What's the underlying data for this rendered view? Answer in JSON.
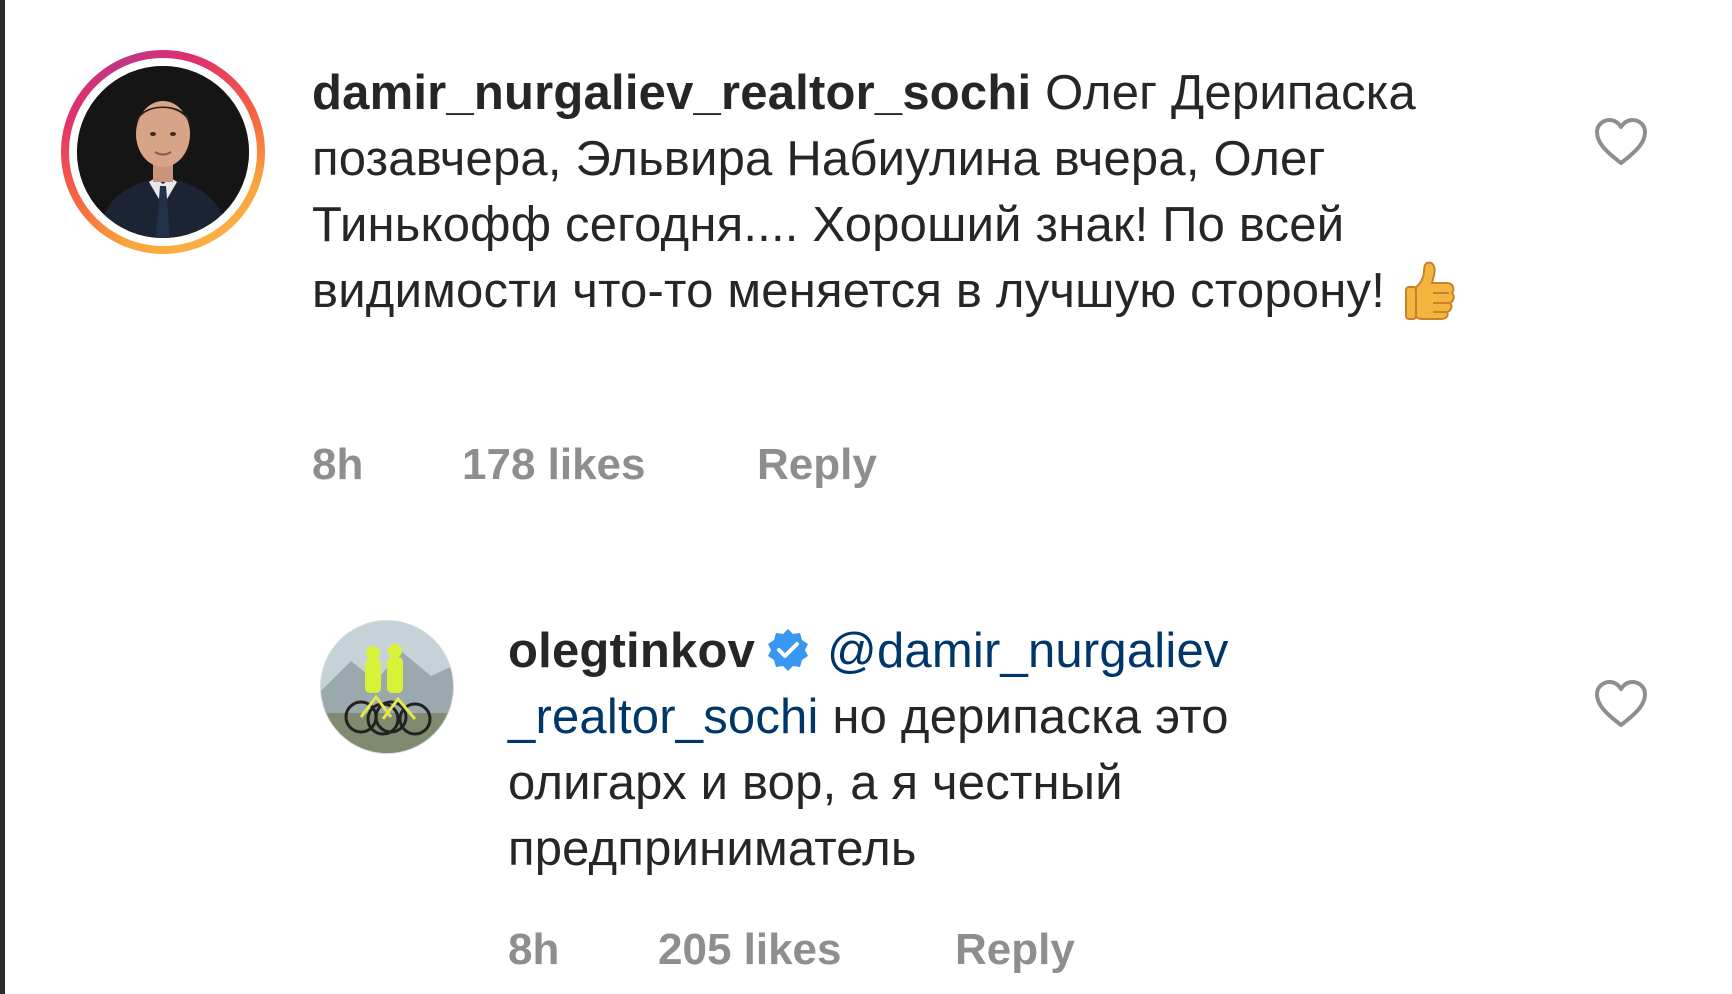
{
  "comments": [
    {
      "username": "damir_nurgaliev_realtor_sochi",
      "text": " Олег Дерипаска позавчера, Эльвира Набиулина вчера, Олег Тинькофф сегодня.... Хороший знак! По всей видимости что-то меняется в лучшую сторону!",
      "emoji_icon": "thumbs-up-icon",
      "time": "8h",
      "likes": "178 likes",
      "reply": "Reply",
      "avatar_ring": "story-ring"
    },
    {
      "username": "olegtinkov",
      "verified": true,
      "mention": "@damir_nurgaliev _realtor_sochi",
      "text": " но дерипаска это олигарх и вор, а я честный предприниматель",
      "time": "8h",
      "likes": "205 likes",
      "reply": "Reply"
    }
  ],
  "colors": {
    "username": "#262626",
    "text": "#262626",
    "mention": "#00376b",
    "meta": "#8e8e8e",
    "verified": "#3897f0",
    "heart_outline": "#8e8e8e"
  }
}
